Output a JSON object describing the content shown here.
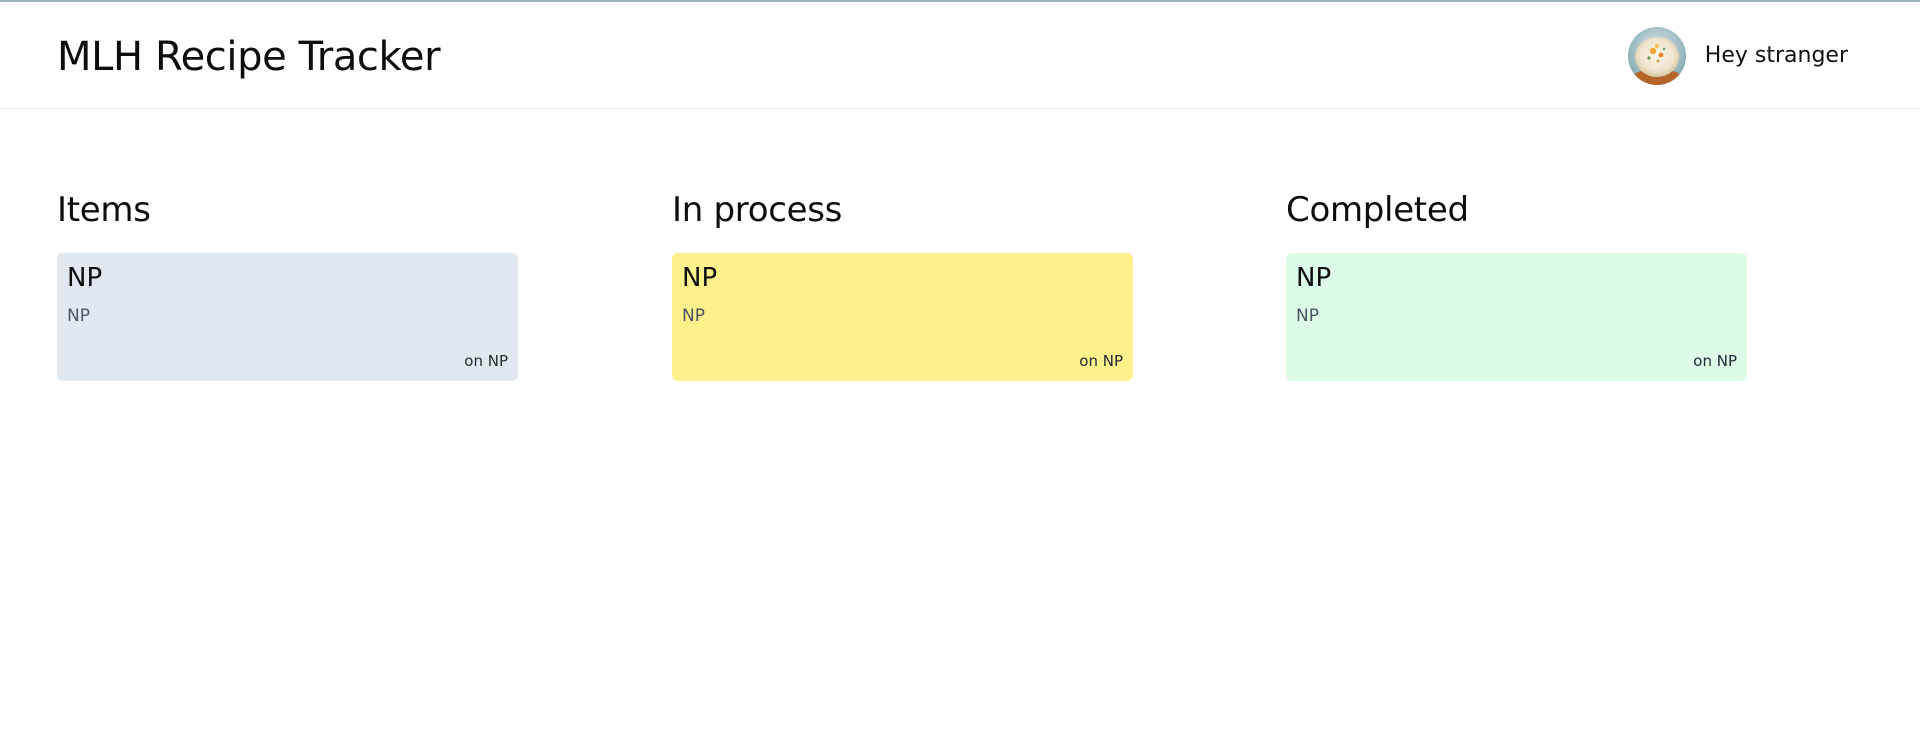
{
  "header": {
    "app_title": "MLH Recipe Tracker",
    "greeting": "Hey stranger",
    "avatar_icon": "recipe-photo-avatar"
  },
  "colors": {
    "top_accent": "#9fb3b8",
    "items_card": "#e2e8f0",
    "in_process_card": "#fef08a",
    "completed_card": "#dcfce7"
  },
  "columns": [
    {
      "title": "Items",
      "cards": [
        {
          "title": "NP",
          "description": "NP",
          "date": "on NP"
        }
      ]
    },
    {
      "title": "In process",
      "cards": [
        {
          "title": "NP",
          "description": "NP",
          "date": "on NP"
        }
      ]
    },
    {
      "title": "Completed",
      "cards": [
        {
          "title": "NP",
          "description": "NP",
          "date": "on NP"
        }
      ]
    }
  ]
}
